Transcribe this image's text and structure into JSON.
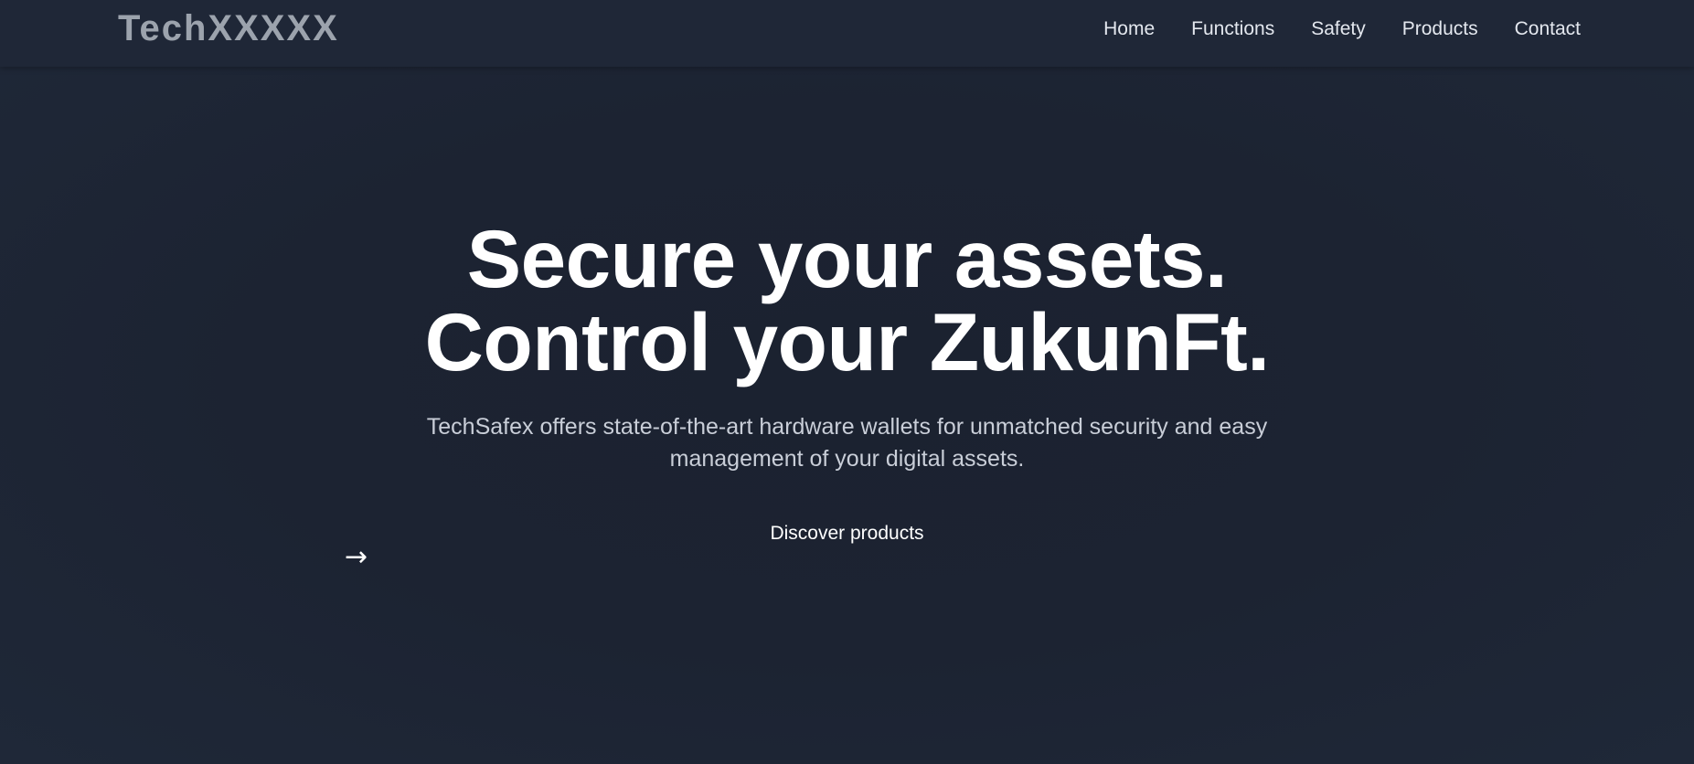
{
  "header": {
    "logo": "TechXXXXX",
    "nav": [
      {
        "label": "Home"
      },
      {
        "label": "Functions"
      },
      {
        "label": "Safety"
      },
      {
        "label": "Products"
      },
      {
        "label": "Contact"
      }
    ]
  },
  "hero": {
    "headline_line1": "Secure your assets.",
    "headline_line2": "Control your ZukunFt.",
    "sub_line1": "TechSafex offers state-of-the-art hardware wallets for unmatched security and easy",
    "sub_line2": "management of your digital assets.",
    "cta_label": "Discover products",
    "arrow_glyph": "→"
  },
  "colors": {
    "background": "#1c2332",
    "header_bg": "#1f2737",
    "logo": "#9ca3ad",
    "text": "#ffffff",
    "subtext": "#c9ced8"
  }
}
